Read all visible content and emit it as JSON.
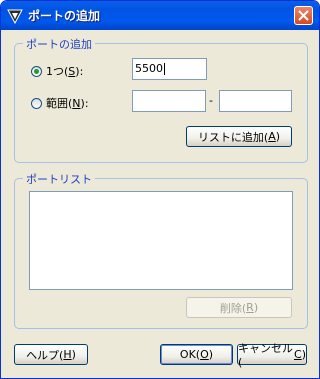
{
  "window": {
    "title": "ポートの追加"
  },
  "add_group": {
    "title": "ポートの追加",
    "single": {
      "label": "1つ(",
      "key": "S",
      "suffix": "):",
      "value": "5500"
    },
    "range": {
      "label": "範囲(",
      "key": "N",
      "suffix": "):",
      "from_value": "",
      "to_value": "",
      "separator": "-"
    },
    "add_button": {
      "label": "リストに追加(",
      "key": "A",
      "suffix": ")"
    }
  },
  "list_group": {
    "title": "ポートリスト",
    "delete_button": {
      "label": "削除(",
      "key": "R",
      "suffix": ")"
    }
  },
  "footer": {
    "help": {
      "label": "ヘルプ(",
      "key": "H",
      "suffix": ")"
    },
    "ok": {
      "label": "OK(",
      "key": "O",
      "suffix": ")"
    },
    "cancel": {
      "label": "キャンセル(",
      "key": "C",
      "suffix": ")"
    }
  }
}
